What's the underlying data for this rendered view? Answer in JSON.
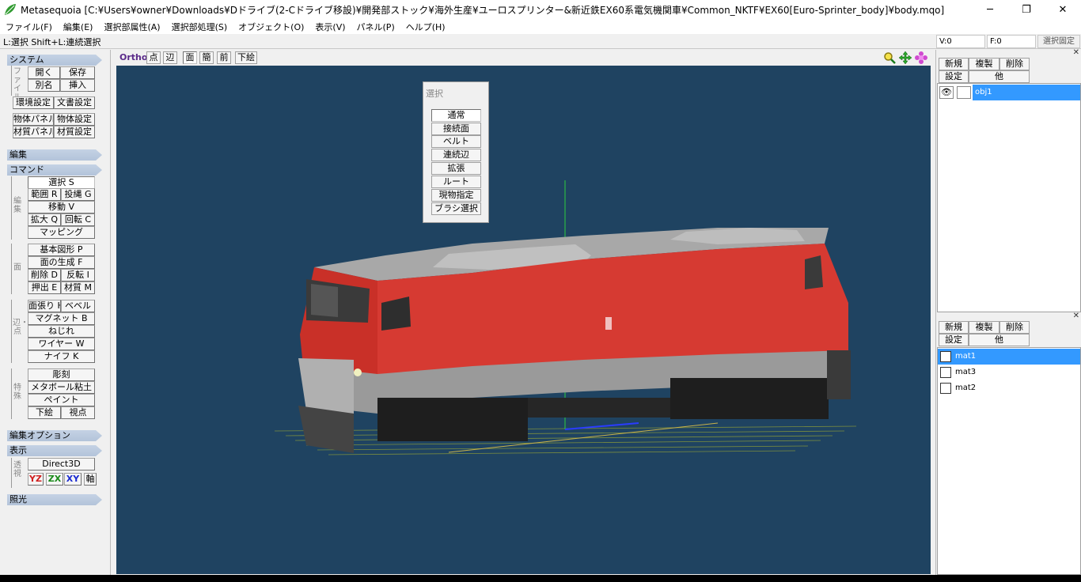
{
  "window": {
    "title": "Metasequoia [C:¥Users¥owner¥Downloads¥Dドライブ(2-Cドライブ移設)¥開発部ストック¥海外生産¥ユーロスプリンター&新近鉄EX60系電気機関車¥Common_NKTF¥EX60[Euro-Sprinter_body]¥body.mqo]",
    "minimize": "─",
    "maximize": "❐",
    "close": "✕"
  },
  "menu": [
    "ファイル(F)",
    "編集(E)",
    "選択部属性(A)",
    "選択部処理(S)",
    "オブジェクト(O)",
    "表示(V)",
    "パネル(P)",
    "ヘルプ(H)"
  ],
  "status": {
    "hint": "L:選択  Shift+L:連続選択",
    "v": "V:0",
    "f": "F:0",
    "fix": "選択固定"
  },
  "left": {
    "system": "システム",
    "file_label": "ファイル",
    "open": "開く",
    "save": "保存",
    "saveas": "別名",
    "insert": "挿入",
    "env": "環境設定",
    "docset": "文書設定",
    "objpanel": "物体パネル",
    "objset": "物体設定",
    "matpanel": "材質パネル",
    "matset": "材質設定",
    "edit": "編集",
    "command": "コマンド",
    "edit_label": "編集",
    "select": "選択 S",
    "range": "範囲 R",
    "lasso": "投縄 G",
    "move": "移動 V",
    "scale": "拡大 Q",
    "rotate": "回転 C",
    "mapping": "マッピング",
    "face_label": "面",
    "basic": "基本図形 P",
    "facegen": "面の生成 F",
    "delete": "削除 D",
    "flip": "反転 I",
    "extrude": "押出 E",
    "material": "材質 M",
    "edge_label": "辺・点",
    "stretch": "面張り H",
    "bevel": "ベベル",
    "magnet": "マグネット B",
    "twist": "ねじれ",
    "wire": "ワイヤー W",
    "knife": "ナイフ K",
    "special_label": "特殊",
    "sculpt": "彫刻",
    "metaball": "メタボール粘土",
    "paint": "ペイント",
    "underlay": "下絵",
    "viewpoint": "視点",
    "editopt": "編集オプション",
    "display": "表示",
    "persp_label": "透視",
    "d3d": "Direct3D",
    "yz": "YZ",
    "zx": "ZX",
    "xy": "XY",
    "axis": "軸",
    "lighting": "照光"
  },
  "viewbar": {
    "ortho": "Ortho",
    "vertex": "点",
    "edge": "辺",
    "face": "面",
    "simple": "簡",
    "front": "前",
    "underlay": "下絵"
  },
  "palette": {
    "title": "選択",
    "items": [
      "通常",
      "接続面",
      "ベルト",
      "連続辺",
      "拡張",
      "ルート",
      "現物指定",
      "ブラシ選択"
    ]
  },
  "objects": {
    "new": "新規",
    "dup": "複製",
    "del": "削除",
    "settings": "設定",
    "other": "他",
    "items": [
      {
        "name": "obj1"
      }
    ]
  },
  "materials": {
    "new": "新規",
    "dup": "複製",
    "del": "削除",
    "settings": "設定",
    "other": "他",
    "items": [
      {
        "name": "mat1"
      },
      {
        "name": "mat3"
      },
      {
        "name": "mat2"
      }
    ]
  },
  "colors": {
    "viewport_bg": "#1f4361",
    "loco_red": "#d63a32",
    "selection": "#3399ff",
    "header": "#b3c4da"
  }
}
